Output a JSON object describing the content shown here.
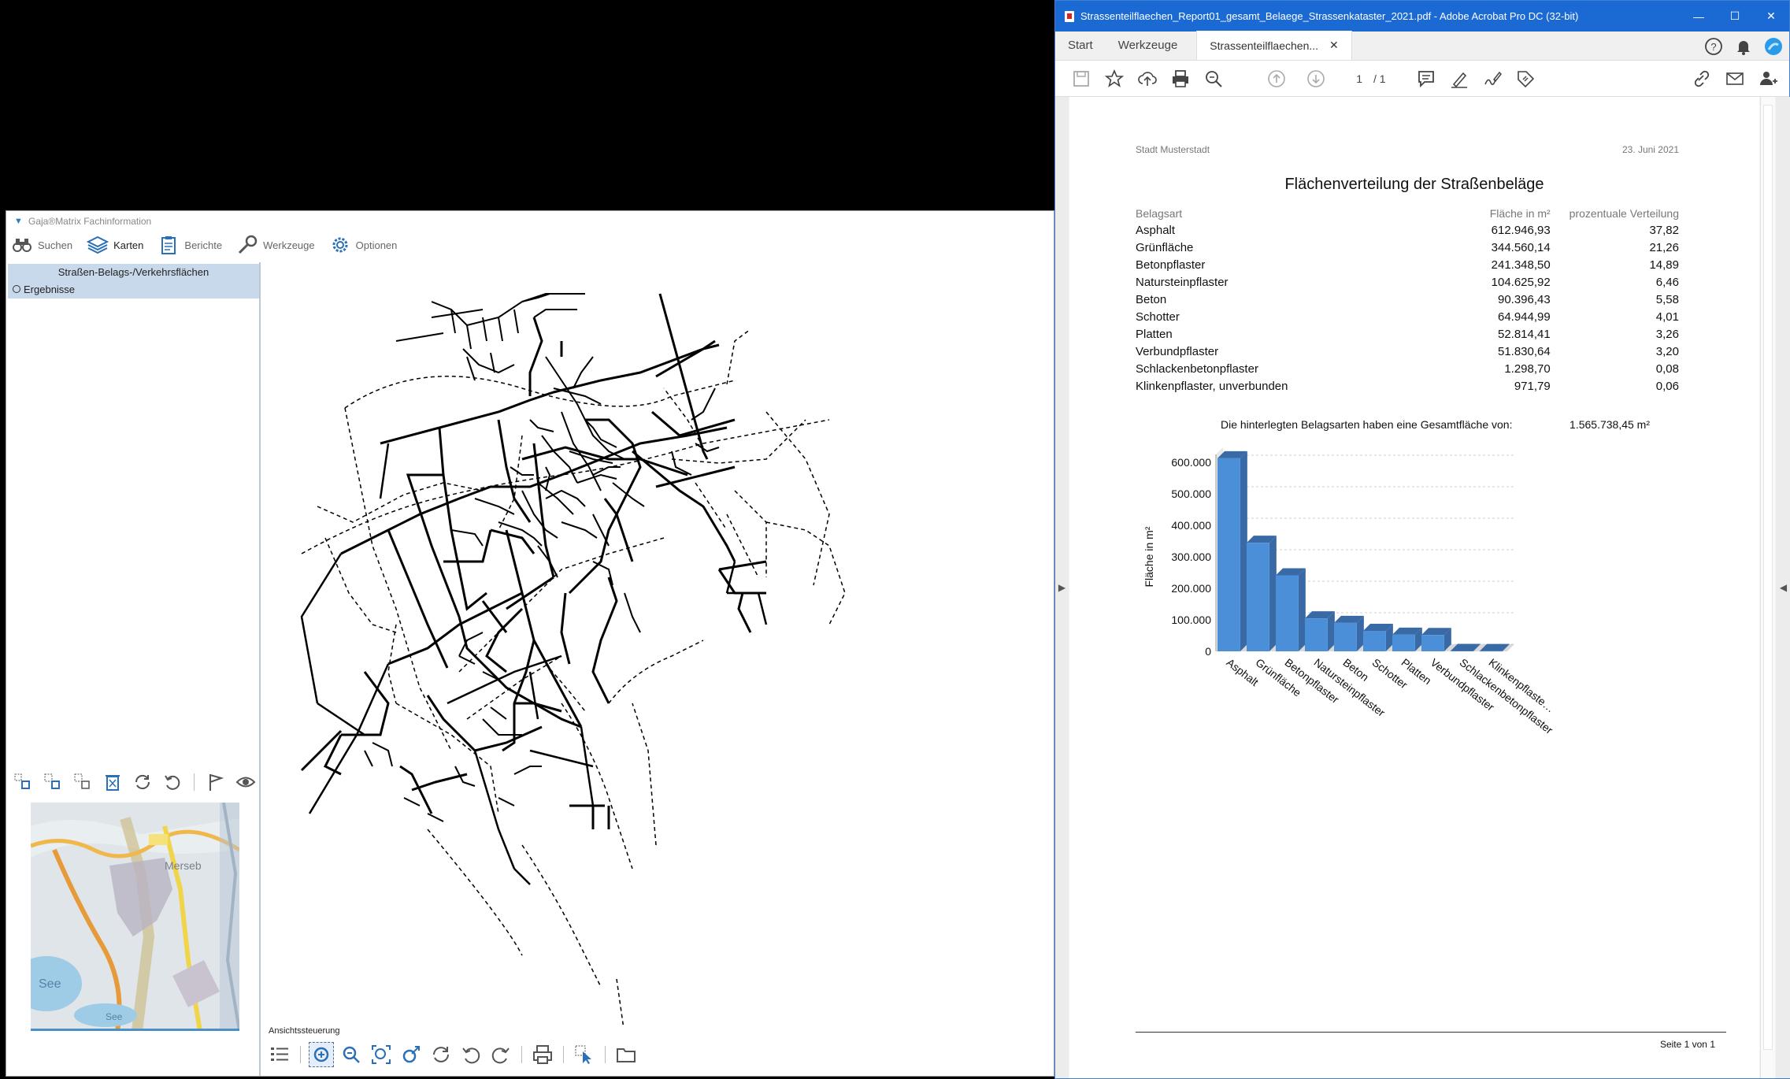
{
  "gaja": {
    "title": "Gaja®Matrix Fachinformation",
    "toolbar": [
      {
        "label": "Suchen",
        "icon": "binoculars-icon"
      },
      {
        "label": "Karten",
        "icon": "layers-icon"
      },
      {
        "label": "Berichte",
        "icon": "clipboard-icon"
      },
      {
        "label": "Werkzeuge",
        "icon": "wrench-icon"
      },
      {
        "label": "Optionen",
        "icon": "gear-icon"
      }
    ],
    "tree": {
      "header": "Straßen-Belags-/Verkehrsflächen",
      "item": "Ergebnisse"
    },
    "view_controls_label": "Ansichtssteuerung",
    "minimap_labels": [
      "Merseb",
      "See",
      "See"
    ]
  },
  "acrobat": {
    "title": "Strassenteilflaechen_Report01_gesamt_Belaege_Strassenkataster_2021.pdf - Adobe Acrobat Pro DC (32-bit)",
    "tabs": {
      "start": "Start",
      "werkzeuge": "Werkzeuge",
      "document": "Strassenteilflaechen..."
    },
    "page_current": "1",
    "page_total": "/ 1"
  },
  "report": {
    "org": "Stadt Musterstadt",
    "date": "23. Juni 2021",
    "title": "Flächenverteilung der Straßenbeläge",
    "columns": [
      "Belagsart",
      "Fläche in m²",
      "prozentuale Verteilung"
    ],
    "rows": [
      [
        "Asphalt",
        "612.946,93",
        "37,82"
      ],
      [
        "Grünfläche",
        "344.560,14",
        "21,26"
      ],
      [
        "Betonpflaster",
        "241.348,50",
        "14,89"
      ],
      [
        "Natursteinpflaster",
        "104.625,92",
        "6,46"
      ],
      [
        "Beton",
        "90.396,43",
        "5,58"
      ],
      [
        "Schotter",
        "64.944,99",
        "4,01"
      ],
      [
        "Platten",
        "52.814,41",
        "3,26"
      ],
      [
        "Verbundpflaster",
        "51.830,64",
        "3,20"
      ],
      [
        "Schlackenbetonpflaster",
        "1.298,70",
        "0,08"
      ],
      [
        "Klinkenpflaster, unverbunden",
        "971,79",
        "0,06"
      ]
    ],
    "total_label": "Die hinterlegten Belagsarten haben eine Gesamtfläche von:",
    "total_value": "1.565.738,45 m²",
    "footer": "Seite 1 von  1"
  },
  "chart_data": {
    "type": "bar",
    "categories": [
      "Asphalt",
      "Grünfläche",
      "Betonpflaster",
      "Natursteinpflaster",
      "Beton",
      "Schotter",
      "Platten",
      "Verbundpflaster",
      "Schlackenbetonpflaster",
      "Klinkenpflaste…"
    ],
    "values": [
      612946.93,
      344560.14,
      241348.5,
      104625.92,
      90396.43,
      64944.99,
      52814.41,
      51830.64,
      1298.7,
      971.79
    ],
    "ylabel": "Fläche in m²",
    "xlabel": "",
    "ylim": [
      0,
      600000
    ],
    "yticks": [
      "0",
      "100.000",
      "200.000",
      "300.000",
      "400.000",
      "500.000",
      "600.000"
    ],
    "grid": true,
    "bar_color": "#4a8fd8",
    "bar_dark": "#3a6aa6"
  }
}
